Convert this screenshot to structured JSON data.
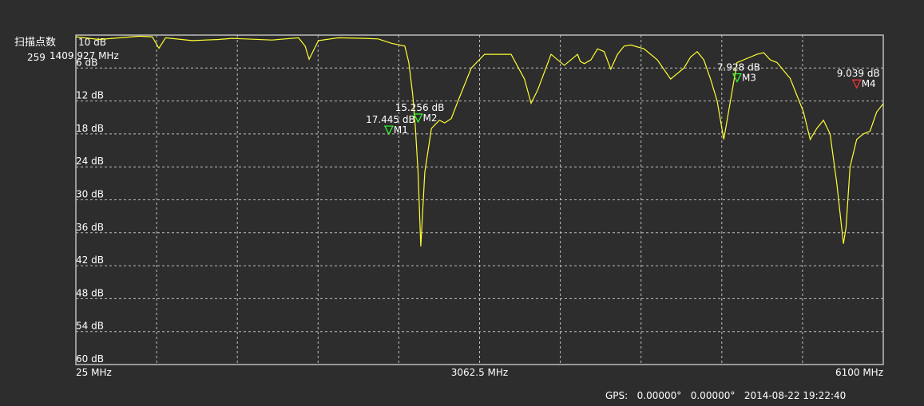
{
  "header": {
    "scan_points_label": "扫描点数",
    "scan_points_value": "259",
    "overlap_text": "10 dB",
    "overlap_freq": "1409.927 MHz"
  },
  "status": {
    "gps_label": "GPS:",
    "lat": "0.00000°",
    "lon": "0.00000°",
    "datetime": "2014-08-22 19:22:40"
  },
  "colors": {
    "trace": "#ffff33",
    "grid": "#bdbdbd",
    "marker_green": "#33ff33",
    "marker_red": "#ff3333",
    "background": "#2d2d2d"
  },
  "chart_data": {
    "type": "line",
    "title": "",
    "xlabel": "",
    "ylabel": "",
    "xlim": [
      25,
      6100
    ],
    "ylim": [
      0,
      60
    ],
    "y_inverted": true,
    "grid": true,
    "x_ticks": [
      {
        "value": 25,
        "label": "25 MHz"
      },
      {
        "value": 3062.5,
        "label": "3062.5 MHz"
      },
      {
        "value": 6100,
        "label": "6100 MHz"
      }
    ],
    "y_ticks": [
      {
        "value": 6,
        "label": "6 dB"
      },
      {
        "value": 12,
        "label": "12 dB"
      },
      {
        "value": 18,
        "label": "18 dB"
      },
      {
        "value": 24,
        "label": "24 dB"
      },
      {
        "value": 30,
        "label": "30 dB"
      },
      {
        "value": 36,
        "label": "36 dB"
      },
      {
        "value": 42,
        "label": "42 dB"
      },
      {
        "value": 48,
        "label": "48 dB"
      },
      {
        "value": 54,
        "label": "54 dB"
      },
      {
        "value": 60,
        "label": "60 dB"
      }
    ],
    "series": [
      {
        "x": [
          25,
          200,
          500,
          600,
          650,
          700,
          900,
          1100,
          1200,
          1300,
          1500,
          1700,
          1750,
          1780,
          1850,
          2000,
          2200,
          2300,
          2400,
          2500,
          2530,
          2560,
          2580,
          2600,
          2620,
          2650,
          2700,
          2760,
          2800,
          2850,
          2900,
          3000,
          3100,
          3300,
          3400,
          3450,
          3500,
          3600,
          3700,
          3800,
          3820,
          3850,
          3900,
          3950,
          4000,
          4050,
          4100,
          4150,
          4200,
          4300,
          4400,
          4500,
          4600,
          4650,
          4700,
          4750,
          4800,
          4850,
          4900,
          5000,
          5100,
          5150,
          5200,
          5250,
          5300,
          5400,
          5500,
          5550,
          5600,
          5650,
          5700,
          5750,
          5800,
          5820,
          5850,
          5900,
          5950,
          6000,
          6050,
          6100
        ],
        "y": [
          0.3,
          0.8,
          0.2,
          0.3,
          2.4,
          0.5,
          1.0,
          0.8,
          0.6,
          0.7,
          0.9,
          0.5,
          2.0,
          4.4,
          1.0,
          0.5,
          0.6,
          0.7,
          1.5,
          2.0,
          5.0,
          11.0,
          17.0,
          25.0,
          38.5,
          25.0,
          17.0,
          15.5,
          16.0,
          15.2,
          12.0,
          6.0,
          3.5,
          3.5,
          8.0,
          12.4,
          10.0,
          3.5,
          5.5,
          3.5,
          4.8,
          5.2,
          4.5,
          2.5,
          3.0,
          6.2,
          3.5,
          2.0,
          1.8,
          2.5,
          4.5,
          8.0,
          6.0,
          4.0,
          3.0,
          4.5,
          8.0,
          12.0,
          19.0,
          5.0,
          4.0,
          3.5,
          3.2,
          4.5,
          5.0,
          7.9,
          14.0,
          19.0,
          17.0,
          15.5,
          18.0,
          27.0,
          38.0,
          35.0,
          24.0,
          19.0,
          18.0,
          17.5,
          14.0,
          12.5
        ]
      }
    ],
    "markers": [
      {
        "name": "M1",
        "x": 2380,
        "y": 17.445,
        "label": "17.445 dB",
        "color": "green"
      },
      {
        "name": "M2",
        "x": 2600,
        "y": 15.256,
        "label": "15.256 dB",
        "color": "green"
      },
      {
        "name": "M3",
        "x": 5000,
        "y": 7.928,
        "label": "7.928 dB",
        "color": "green"
      },
      {
        "name": "M4",
        "x": 5900,
        "y": 9.039,
        "label": "9.039 dB",
        "color": "red"
      }
    ]
  }
}
